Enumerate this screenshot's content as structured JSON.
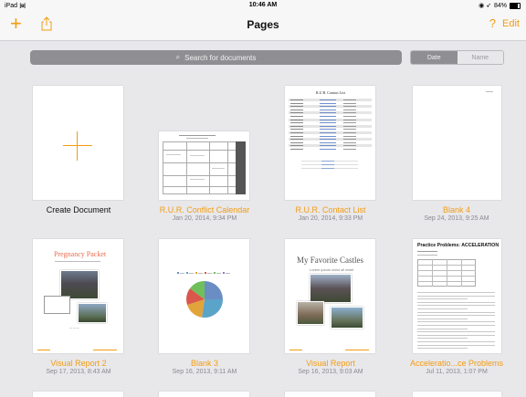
{
  "status_bar": {
    "device": "iPad",
    "time": "10:46 AM",
    "battery": "84%",
    "battery_level": 0.84
  },
  "nav": {
    "title": "Pages",
    "add_icon": "plus-icon",
    "share_icon": "share-icon",
    "help_label": "?",
    "edit_label": "Edit"
  },
  "search": {
    "placeholder": "Search for documents",
    "icon": "search-icon"
  },
  "sort": {
    "options": [
      "Date",
      "Name"
    ],
    "selected": "Date"
  },
  "colors": {
    "accent": "#f39c12",
    "search_bg": "#8e8e93",
    "background": "#e8e8eb"
  },
  "documents": [
    {
      "title": "Create Document",
      "date": ""
    },
    {
      "title": "R.U.R. Conflict Calendar",
      "date": "Jan 20, 2014, 9:34 PM"
    },
    {
      "title": "R.U.R. Contact List",
      "date": "Jan 20, 2014, 9:33 PM"
    },
    {
      "title": "Blank 4",
      "date": "Sep 24, 2013, 9:25 AM"
    },
    {
      "title": "Visual Report 2",
      "date": "Sep 17, 2013, 8:43 AM"
    },
    {
      "title": "Blank 3",
      "date": "Sep 16, 2013, 9:11 AM"
    },
    {
      "title": "Visual Report",
      "date": "Sep 16, 2013, 9:03 AM"
    },
    {
      "title": "Acceleratio...ce Problems",
      "date": "Jul 11, 2013, 1:07 PM"
    }
  ],
  "thumbnails": {
    "contact_list_heading": "R.U.R. Contact List",
    "visual_report_2_heading": "Pregnancy Packet",
    "visual_report_heading": "My Favorite Castles",
    "visual_report_sub": "Lorem ipsum dolor sit amet",
    "acceleration_heading": "Practice Problems: ACCELERATION"
  }
}
